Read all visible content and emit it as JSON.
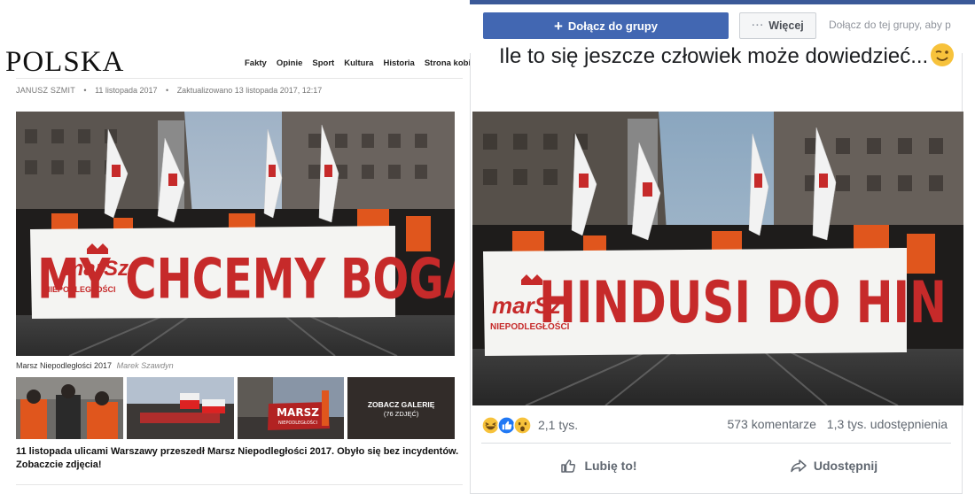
{
  "article": {
    "masthead": "POLSKA",
    "nav": [
      "Fakty",
      "Opinie",
      "Sport",
      "Kultura",
      "Historia",
      "Strona kobiet"
    ],
    "author": "JANUSZ SZMIT",
    "date": "11 listopada 2017",
    "updated": "Zaktualizowano 13 listopada 2017, 12:17",
    "hero_banner_logo_top": "marSz",
    "hero_banner_logo_bottom": "NIEPODLEGŁOŚCI",
    "hero_banner_text": "MY CHCEMY BOGA",
    "caption": "Marsz Niepodległości 2017",
    "caption_credit": "Marek Szawdyn",
    "thumb3_sign_top": "MARSZ",
    "thumb3_sign_bottom": "NIEPODLEGŁOŚCI",
    "gallery_label": "ZOBACZ GALERIĘ",
    "gallery_count": "(76 ZDJĘĆ)",
    "headline": "11 listopada ulicami Warszawy przeszedł Marsz Niepodległości 2017. Obyło się bez incydentów. Zobaczcie zdjęcia!"
  },
  "facebook": {
    "join_button": "Dołącz do grupy",
    "more_button": "Więcej",
    "join_hint": "Dołącz do tej grupy, aby p",
    "post_text": "Ile to się jeszcze człowiek może dowiedzieć...",
    "image_banner_logo_top": "marSz",
    "image_banner_logo_bottom": "NIEPODLEGŁOŚCI",
    "image_banner_text": "HINDUSI DO HIN",
    "reaction_icons": [
      "haha-icon",
      "like-icon",
      "wow-icon"
    ],
    "reaction_count": "2,1 tys.",
    "comments": "573 komentarze",
    "shares": "1,3 tys. udostępnienia",
    "like_action": "Lubię to!",
    "share_action": "Udostępnij",
    "colors": {
      "brand": "#4267b2",
      "topbar": "#3b5998",
      "banner_red": "#c62a2a"
    }
  }
}
